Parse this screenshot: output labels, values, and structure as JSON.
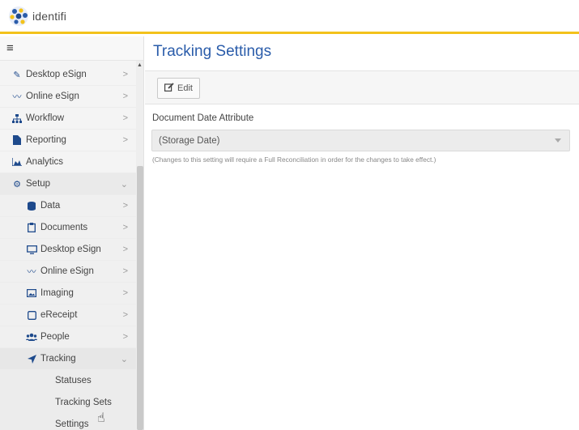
{
  "app": {
    "logo_text": "identifi",
    "brand_accent": "#f3c21b",
    "title_color": "#2a5caa"
  },
  "sidebar": {
    "menu_icon": "hamburger-icon",
    "items": [
      {
        "label": "Desktop eSign",
        "icon": "pencil-icon",
        "chevron": ">"
      },
      {
        "label": "Online eSign",
        "icon": "signature-icon",
        "chevron": ">"
      },
      {
        "label": "Workflow",
        "icon": "sitemap-icon",
        "chevron": ">"
      },
      {
        "label": "Reporting",
        "icon": "file-icon",
        "chevron": ">"
      },
      {
        "label": "Analytics",
        "icon": "chart-area-icon",
        "chevron": ""
      },
      {
        "label": "Setup",
        "icon": "gear-icon",
        "chevron": "⌄"
      },
      {
        "label": "Data",
        "icon": "database-icon",
        "chevron": ">"
      },
      {
        "label": "Documents",
        "icon": "clipboard-icon",
        "chevron": ">"
      },
      {
        "label": "Desktop eSign",
        "icon": "desktop-icon",
        "chevron": ">"
      },
      {
        "label": "Online eSign",
        "icon": "signature-icon",
        "chevron": ">"
      },
      {
        "label": "Imaging",
        "icon": "image-icon",
        "chevron": ">"
      },
      {
        "label": "eReceipt",
        "icon": "receipt-icon",
        "chevron": ">"
      },
      {
        "label": "People",
        "icon": "users-icon",
        "chevron": ">"
      },
      {
        "label": "Tracking",
        "icon": "location-arrow-icon",
        "chevron": "⌄"
      },
      {
        "label": "Statuses"
      },
      {
        "label": "Tracking Sets"
      },
      {
        "label": "Settings"
      }
    ]
  },
  "main": {
    "title": "Tracking Settings",
    "edit_label": "Edit",
    "field_label": "Document Date Attribute",
    "field_value": "(Storage Date)",
    "help_text": "(Changes to this setting will require a Full Reconciliation in order for the changes to take effect.)"
  }
}
